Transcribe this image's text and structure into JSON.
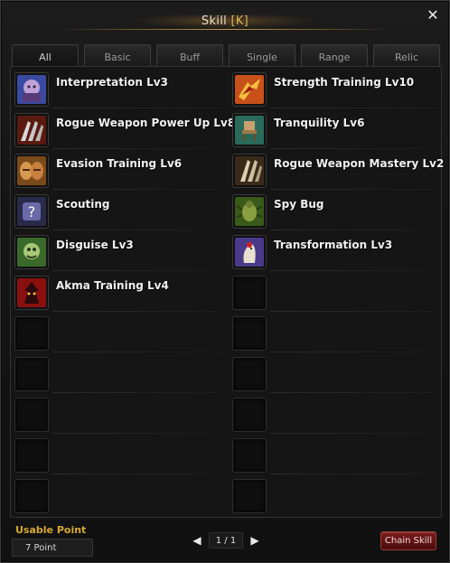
{
  "window": {
    "title": "Skill",
    "hotkey": "[K]",
    "close_symbol": "✕"
  },
  "tabs": [
    {
      "label": "All",
      "active": true
    },
    {
      "label": "Basic",
      "active": false
    },
    {
      "label": "Buff",
      "active": false
    },
    {
      "label": "Single",
      "active": false
    },
    {
      "label": "Range",
      "active": false
    },
    {
      "label": "Relic",
      "active": false
    }
  ],
  "skills": {
    "left": [
      {
        "label": "Interpretation Lv3",
        "icon": "interpretation-icon"
      },
      {
        "label": "Rogue Weapon Power Up Lv8",
        "icon": "rogue-weapon-power-icon"
      },
      {
        "label": "Evasion Training Lv6",
        "icon": "evasion-training-icon"
      },
      {
        "label": "Scouting",
        "icon": "scouting-icon"
      },
      {
        "label": "Disguise Lv3",
        "icon": "disguise-icon"
      },
      {
        "label": "Akma Training Lv4",
        "icon": "akma-training-icon"
      }
    ],
    "right": [
      {
        "label": "Strength Training Lv10",
        "icon": "strength-training-icon"
      },
      {
        "label": "Tranquility Lv6",
        "icon": "tranquility-icon"
      },
      {
        "label": "Rogue Weapon Mastery Lv2",
        "icon": "rogue-weapon-mastery-icon"
      },
      {
        "label": "Spy Bug",
        "icon": "spy-bug-icon"
      },
      {
        "label": "Transformation Lv3",
        "icon": "transformation-icon"
      }
    ]
  },
  "footer": {
    "usable_point_label": "Usable Point",
    "usable_point_value": "7 Point",
    "page_indicator": "1 / 1",
    "prev_symbol": "◀",
    "next_symbol": "▶",
    "chain_skill_label": "Chain Skill"
  },
  "colors": {
    "accent_gold": "#d8a830",
    "chain_button_red": "#7a1c1c"
  }
}
